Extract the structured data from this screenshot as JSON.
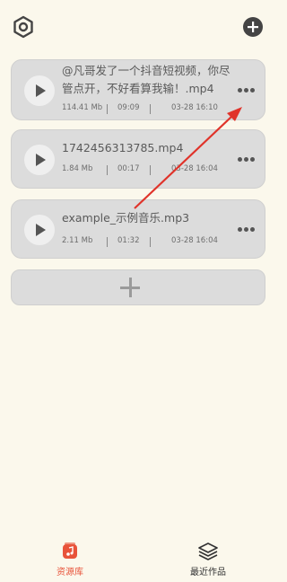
{
  "header": {
    "settings_icon": "hexagon-gear-icon",
    "add_icon": "plus-circle-icon"
  },
  "files": [
    {
      "name": "@凡哥发了一个抖音短视频，你尽管点开，不好看算我输！.mp4",
      "size": "114.41 Mb",
      "duration": "09:09",
      "date": "03-28 16:10"
    },
    {
      "name": "1742456313785.mp4",
      "size": "1.84 Mb",
      "duration": "00:17",
      "date": "03-28 16:04"
    },
    {
      "name": "example_示例音乐.mp3",
      "size": "2.11 Mb",
      "duration": "01:32",
      "date": "03-28 16:04"
    }
  ],
  "add_card": {
    "icon": "plus-icon"
  },
  "nav": {
    "library_label": "资源库",
    "recent_label": "最近作品",
    "active_color": "#e8533a",
    "inactive_color": "#333333"
  },
  "annotation": {
    "color": "#e0332a"
  }
}
